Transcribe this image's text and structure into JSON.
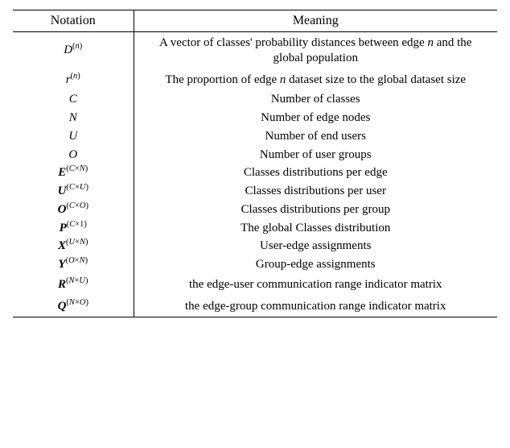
{
  "header": {
    "notation": "Notation",
    "meaning": "Meaning"
  },
  "rows": [
    {
      "notation_html": "<span class='sym'>D</span><sup>(<span class='sym'>n</span>)</sup>",
      "meaning": "A vector of classes' probability distances between edge n and the global population",
      "tall": true
    },
    {
      "notation_html": "<span class='sym'>r</span><sup>(<span class='sym'>n</span>)</sup>",
      "meaning": "The proportion of edge n dataset size to the global dataset size",
      "tall": true
    },
    {
      "notation_html": "<span class='sym'>C</span>",
      "meaning": "Number of classes"
    },
    {
      "notation_html": "<span class='sym'>N</span>",
      "meaning": "Number of edge nodes"
    },
    {
      "notation_html": "<span class='sym'>U</span>",
      "meaning": "Number of end users"
    },
    {
      "notation_html": "<span class='sym'>O</span>",
      "meaning": "Number of user groups"
    },
    {
      "notation_html": "<span class='bold'>E</span><sup>(<span class='sym'>C</span>×<span class='sym'>N</span>)</sup>",
      "meaning": "Classes distributions per edge"
    },
    {
      "notation_html": "<span class='bold'>U</span><sup>(<span class='sym'>C</span>×<span class='sym'>U</span>)</sup>",
      "meaning": "Classes distributions per user"
    },
    {
      "notation_html": "<span class='bold'>O</span><sup>(<span class='sym'>C</span>×<span class='sym'>O</span>)</sup>",
      "meaning": "Classes distributions per group"
    },
    {
      "notation_html": "<span class='bold'>P</span><sup>(<span class='sym'>C</span>×1)</sup>",
      "meaning": "The global Classes distribution"
    },
    {
      "notation_html": "<span class='bold'>X</span><sup>(<span class='sym'>U</span>×<span class='sym'>N</span>)</sup>",
      "meaning": "User-edge assignments"
    },
    {
      "notation_html": "<span class='bold'>Y</span><sup>(<span class='sym'>O</span>×<span class='sym'>N</span>)</sup>",
      "meaning": "Group-edge assignments"
    },
    {
      "notation_html": "<span class='bold'>R</span><sup>(<span class='sym'>N</span>×<span class='sym'>U</span>)</sup>",
      "meaning": "the edge-user communication range indicator matrix",
      "tall": true
    },
    {
      "notation_html": "<span class='bold'>Q</span><sup>(<span class='sym'>N</span>×<span class='sym'>O</span>)</sup>",
      "meaning": "the edge-group communication range indicator matrix",
      "tall": true
    }
  ]
}
